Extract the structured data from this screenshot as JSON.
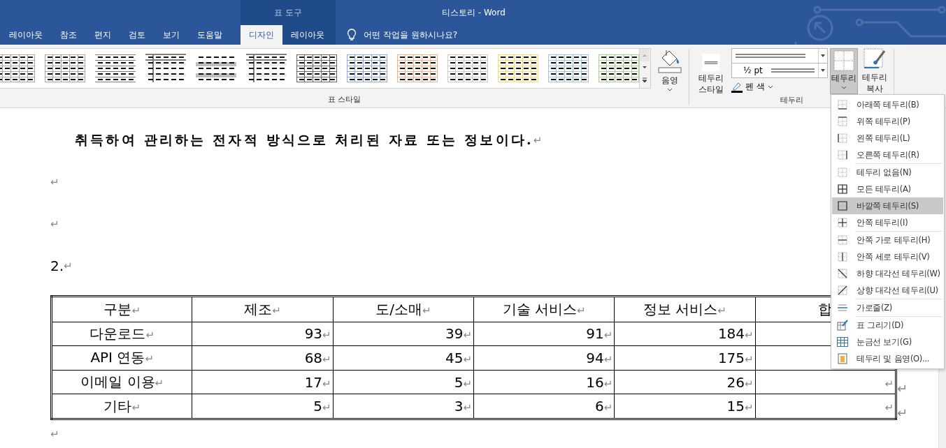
{
  "window": {
    "title": "티스토리 - Word",
    "context_group": "표 도구"
  },
  "tabs": [
    {
      "label": "레이아웃",
      "selected": false,
      "contextual": false
    },
    {
      "label": "참조",
      "selected": false,
      "contextual": false
    },
    {
      "label": "편지",
      "selected": false,
      "contextual": false
    },
    {
      "label": "검토",
      "selected": false,
      "contextual": false
    },
    {
      "label": "보기",
      "selected": false,
      "contextual": false
    },
    {
      "label": "도움말",
      "selected": false,
      "contextual": false
    },
    {
      "label": "디자인",
      "selected": true,
      "contextual": true
    },
    {
      "label": "레이아웃",
      "selected": false,
      "contextual": true
    }
  ],
  "tell_me": {
    "placeholder": "어떤 작업을 원하시나요?"
  },
  "ribbon": {
    "table_styles": {
      "label": "표 스타일",
      "styles": [
        {
          "kind": "grid",
          "color": "#a6a6a6"
        },
        {
          "kind": "grid",
          "color": "#a6a6a6"
        },
        {
          "kind": "rules",
          "color": "#7f7f7f"
        },
        {
          "kind": "first-col",
          "color": "#7f7f7f"
        },
        {
          "kind": "banded",
          "color": "#bfbfbf"
        },
        {
          "kind": "first-col",
          "color": "#7f7f7f"
        },
        {
          "kind": "grid",
          "color": "#666666"
        },
        {
          "kind": "grid",
          "color": "#8eaadb"
        },
        {
          "kind": "grid",
          "color": "#f4b183"
        },
        {
          "kind": "grid",
          "color": "#c9c9c9"
        },
        {
          "kind": "grid",
          "color": "#ffd966"
        },
        {
          "kind": "grid",
          "color": "#9dc3e6"
        },
        {
          "kind": "grid",
          "color": "#a9d18e"
        }
      ]
    },
    "shading": {
      "label": "음영"
    },
    "borders": {
      "label": "테두리",
      "border_styles": "테두리 스타일",
      "weight": "½ pt",
      "pen_color": "펜 색",
      "borders_button": {
        "label": "테두리",
        "pressed": true
      },
      "border_painter": "테두리 복사"
    }
  },
  "document": {
    "paragraphs": [
      {
        "kind": "bold",
        "text": "취득하여 관리하는 전자적 방식으로 처리된 자료 또는 정보이다.",
        "end_mark": "↵"
      },
      {
        "kind": "empty",
        "end_mark": "↵"
      },
      {
        "kind": "empty",
        "end_mark": "↵"
      },
      {
        "kind": "normal",
        "text": "2.",
        "end_mark": "↵"
      }
    ],
    "table": {
      "header": [
        {
          "text": "구분",
          "end_mark": "↵"
        },
        {
          "text": "제조",
          "end_mark": "↵"
        },
        {
          "text": "도/소매",
          "end_mark": "↵"
        },
        {
          "text": "기술 서비스",
          "end_mark": "↵"
        },
        {
          "text": "정보 서비스",
          "end_mark": "↵"
        },
        {
          "text": "합"
        }
      ],
      "rows": [
        {
          "cells": [
            {
              "text": "다운로드",
              "end_mark": "↵"
            },
            {
              "text": "93",
              "end_mark": "↵"
            },
            {
              "text": "39",
              "end_mark": "↵"
            },
            {
              "text": "91",
              "end_mark": "↵"
            },
            {
              "text": "184",
              "end_mark": "↵"
            },
            {}
          ]
        },
        {
          "cells": [
            {
              "text": "API 연동",
              "end_mark": "↵"
            },
            {
              "text": "68",
              "end_mark": "↵"
            },
            {
              "text": "45",
              "end_mark": "↵"
            },
            {
              "text": "94",
              "end_mark": "↵"
            },
            {
              "text": "175",
              "end_mark": "↵"
            },
            {}
          ]
        },
        {
          "cells": [
            {
              "text": "이메일 이용",
              "end_mark": "↵"
            },
            {
              "text": "17",
              "end_mark": "↵"
            },
            {
              "text": "5",
              "end_mark": "↵"
            },
            {
              "text": "16",
              "end_mark": "↵"
            },
            {
              "text": "26",
              "end_mark": "↵"
            },
            {
              "end_mark": "↵"
            }
          ],
          "row_end_mark": "↵"
        },
        {
          "cells": [
            {
              "text": "기타",
              "end_mark": "↵"
            },
            {
              "text": "5",
              "end_mark": "↵"
            },
            {
              "text": "3",
              "end_mark": "↵"
            },
            {
              "text": "6",
              "end_mark": "↵"
            },
            {
              "text": "15",
              "end_mark": "↵"
            },
            {
              "end_mark": "↵"
            }
          ],
          "row_end_mark": "↵"
        }
      ]
    },
    "after_table": {
      "end_mark": "↵"
    }
  },
  "borders_menu": {
    "items": [
      {
        "kind": "bottom",
        "label": "아래쪽 테두리(B)",
        "selected": false,
        "separator_after": false
      },
      {
        "kind": "top",
        "label": "위쪽 테두리(P)",
        "selected": false,
        "separator_after": false
      },
      {
        "kind": "left",
        "label": "왼쪽 테두리(L)",
        "selected": false,
        "separator_after": false
      },
      {
        "kind": "right",
        "label": "오른쪽 테두리(R)",
        "selected": false,
        "separator_after": true
      },
      {
        "kind": "none",
        "label": "테두리 없음(N)",
        "selected": false,
        "separator_after": false
      },
      {
        "kind": "all",
        "label": "모든 테두리(A)",
        "selected": false,
        "separator_after": false
      },
      {
        "kind": "outside",
        "label": "바깥쪽 테두리(S)",
        "selected": true,
        "separator_after": false
      },
      {
        "kind": "inside",
        "label": "안쪽 테두리(I)",
        "selected": false,
        "separator_after": true
      },
      {
        "kind": "inside-h",
        "label": "안쪽 가로 테두리(H)",
        "selected": false,
        "separator_after": false
      },
      {
        "kind": "inside-v",
        "label": "안쪽 세로 테두리(V)",
        "selected": false,
        "separator_after": false
      },
      {
        "kind": "diag-down",
        "label": "하향 대각선 테두리(W)",
        "selected": false,
        "separator_after": false
      },
      {
        "kind": "diag-up",
        "label": "상향 대각선 테두리(U)",
        "selected": false,
        "separator_after": true
      },
      {
        "kind": "hline",
        "label": "가로줄(Z)",
        "selected": false,
        "separator_after": true
      },
      {
        "kind": "draw",
        "label": "표 그리기(D)",
        "selected": false,
        "separator_after": false
      },
      {
        "kind": "gridlines",
        "label": "눈금선 보기(G)",
        "selected": false,
        "separator_after": false
      },
      {
        "kind": "shading",
        "label": "테두리 및 음영(O)...",
        "selected": false,
        "separator_after": false
      }
    ]
  }
}
